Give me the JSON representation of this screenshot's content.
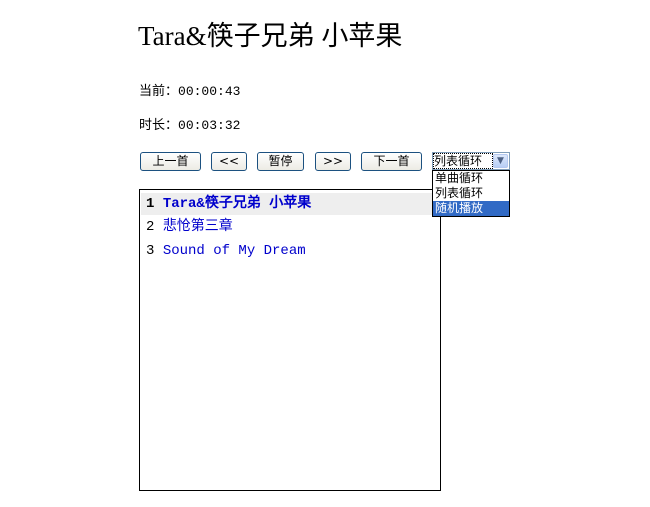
{
  "now_playing": {
    "title": "Tara&筷子兄弟  小苹果",
    "current_label": "当前：",
    "current_time": "00:00:43",
    "duration_label": "时长：",
    "duration_time": "00:03:32"
  },
  "controls": {
    "prev_label": "上一首",
    "rewind_label": "<<",
    "pause_label": "暂停",
    "forward_label": ">>",
    "next_label": "下一首"
  },
  "play_mode": {
    "selected": "列表循环",
    "options": [
      "单曲循环",
      "列表循环",
      "随机播放"
    ],
    "highlighted_index": 2,
    "arrow_icon": "chevron-down-icon"
  },
  "playlist": {
    "tracks": [
      {
        "num": "1",
        "name": "Tara&筷子兄弟 小苹果",
        "active": true
      },
      {
        "num": "2",
        "name": "悲怆第三章",
        "active": false
      },
      {
        "num": "3",
        "name": "Sound of My Dream",
        "active": false
      }
    ]
  },
  "colors": {
    "track_link": "#0000cc",
    "option_highlight": "#316ac5",
    "active_row_bg": "#eeeeee"
  }
}
